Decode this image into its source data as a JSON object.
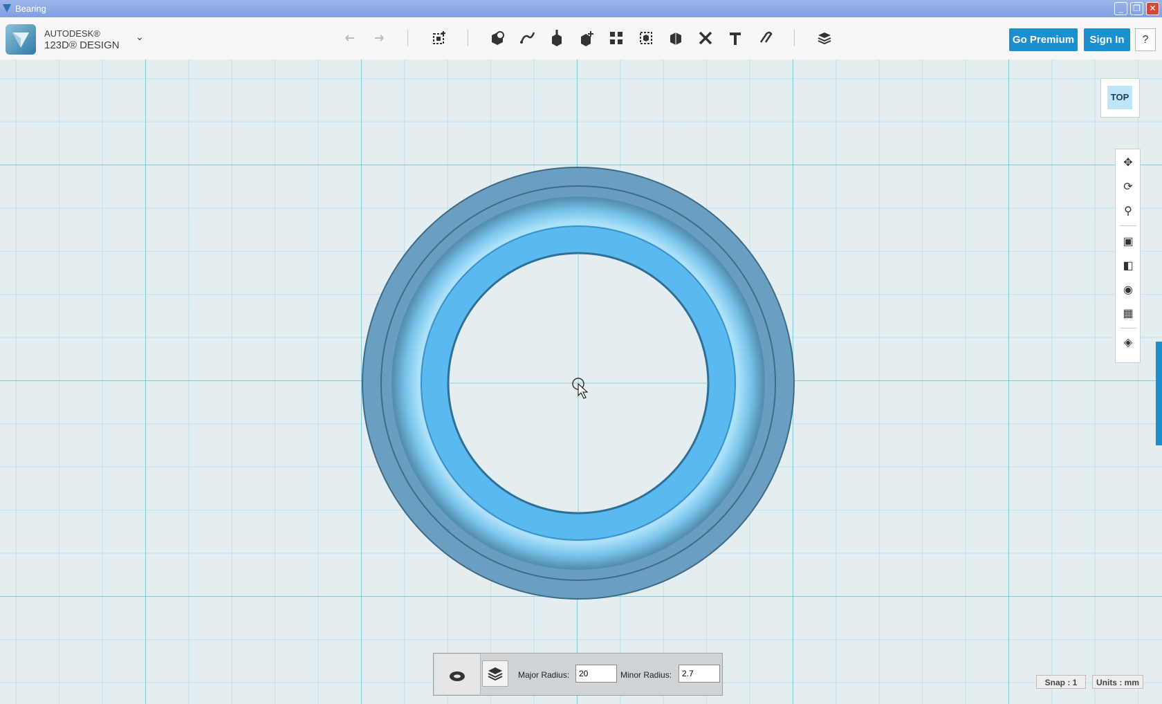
{
  "window": {
    "title": "Bearing"
  },
  "header": {
    "brand_line1": "AUTODESK®",
    "brand_line2": "123D® DESIGN",
    "go_premium": "Go Premium",
    "sign_in": "Sign In",
    "help": "?"
  },
  "toolbar_icons": [
    "undo-icon",
    "redo-icon",
    "transform-icon",
    "primitives-icon",
    "sketch-icon",
    "construct-icon",
    "modify-icon",
    "pattern-icon",
    "grouping-icon",
    "combine-icon",
    "measure-icon",
    "text-icon",
    "snap-icon",
    "material-icon"
  ],
  "viewcube": {
    "face": "TOP"
  },
  "nav_icons": [
    "pan-icon",
    "orbit-icon",
    "zoom-icon",
    "fit-icon",
    "views-icon",
    "visibility-icon",
    "grid-icon",
    "material-edit-icon"
  ],
  "properties": {
    "major_label": "Major Radius:",
    "major_value": "20",
    "minor_label": "Minor Radius:",
    "minor_value": "2.7"
  },
  "status": {
    "snap": "Snap : 1",
    "units": "Units : mm"
  },
  "colors": {
    "accent": "#1b8fd0",
    "torus": "#5ab9ef",
    "outer": "#6a9fc1"
  }
}
